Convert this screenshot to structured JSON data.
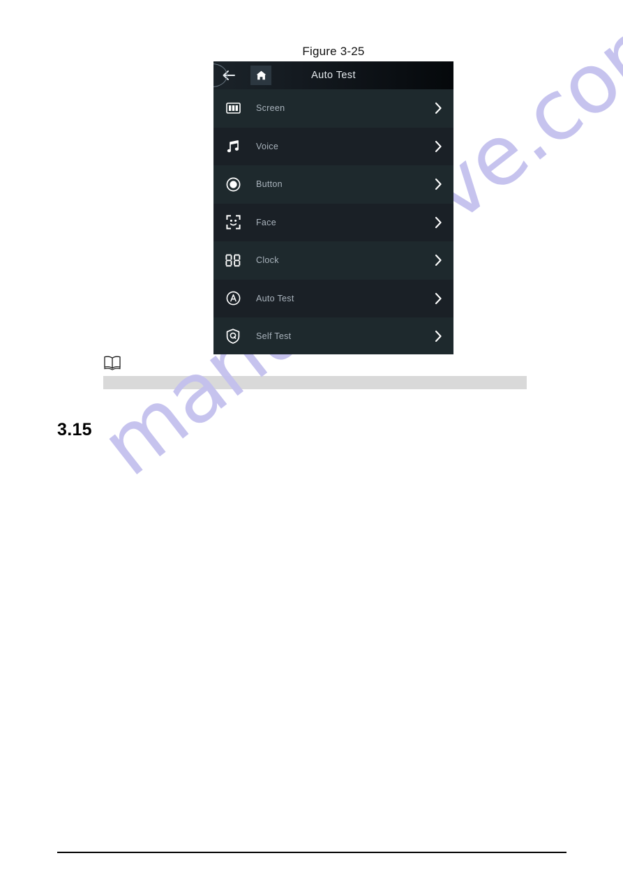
{
  "document": {
    "figure_caption": "Figure 3-25",
    "section_number": "3.15",
    "note_icon": "open-book-icon",
    "redacted_note_text": ""
  },
  "watermark": {
    "text": "manualshive.com",
    "color": "#c3c0ee"
  },
  "device": {
    "header": {
      "title": "Auto Test",
      "back_icon": "back-arrow-icon",
      "home_icon": "home-icon"
    },
    "theme": {
      "panel_bg": "#1d272b",
      "row_odd_bg": "#1e292d",
      "row_even_bg": "#1a2026",
      "label_color": "#aab4bd",
      "title_color": "#e6ebef"
    },
    "menu_items": [
      {
        "label": "Screen",
        "icon": "screen-icon",
        "chevron": "chevron-right-icon"
      },
      {
        "label": "Voice",
        "icon": "music-note-icon",
        "chevron": "chevron-right-icon"
      },
      {
        "label": "Button",
        "icon": "button-circle-icon",
        "chevron": "chevron-right-icon"
      },
      {
        "label": "Face",
        "icon": "face-detect-icon",
        "chevron": "chevron-right-icon"
      },
      {
        "label": "Clock",
        "icon": "digital-clock-icon",
        "chevron": "chevron-right-icon"
      },
      {
        "label": "Auto Test",
        "icon": "auto-test-icon",
        "chevron": "chevron-right-icon"
      },
      {
        "label": "Self Test",
        "icon": "shield-self-test-icon",
        "chevron": "chevron-right-icon"
      }
    ]
  }
}
